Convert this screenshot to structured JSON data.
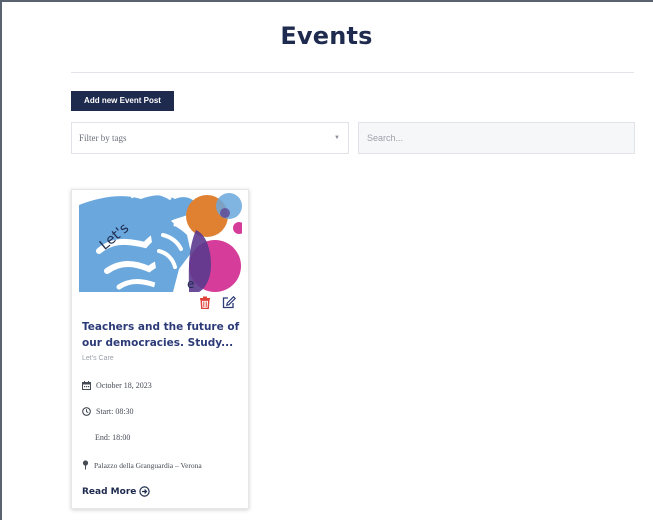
{
  "page": {
    "title": "Events"
  },
  "toolbar": {
    "add_button_label": "Add new Event Post",
    "filter_label": "Filter by tags",
    "search_placeholder": "Search..."
  },
  "events": [
    {
      "image_text": "Let's",
      "title": "Teachers and the future of our democracies. Study...",
      "organizer": "Let's Care",
      "date": "October 18, 2023",
      "start": "Start: 08:30",
      "end": "End: 18:00",
      "location": "Palazzo della Granguardia – Verona",
      "read_more_label": "Read More"
    }
  ],
  "colors": {
    "navy": "#1e2a4e",
    "title_blue": "#2c3a78",
    "delete_red": "#e0403a",
    "edit_blue": "#2c3a78",
    "hands_blue": "#6aa7dc",
    "orange": "#e08132",
    "magenta": "#d63d9a",
    "purple": "#5b3a8e"
  },
  "icons": {
    "delete": "trash-icon",
    "edit": "edit-icon",
    "date": "calendar-icon",
    "time": "clock-icon",
    "location": "map-pin-icon",
    "read_more": "arrow-circle-right-icon",
    "filter": "caret-down-icon"
  }
}
